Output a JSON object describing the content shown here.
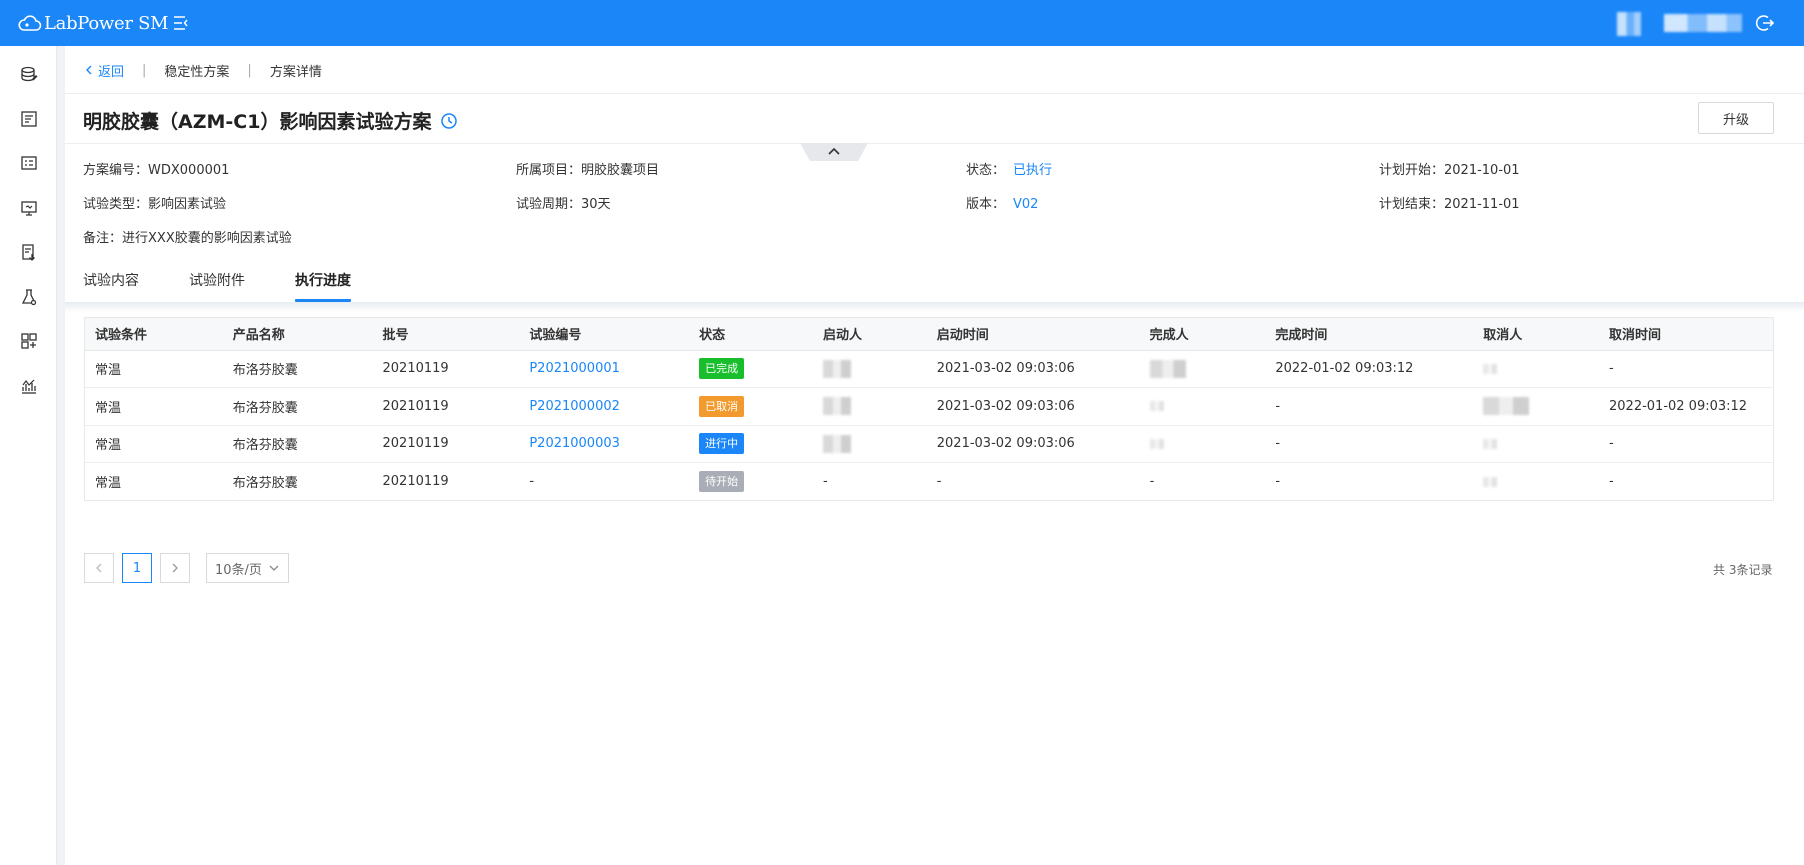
{
  "header": {
    "app_name": "LabPower SM"
  },
  "breadcrumb": {
    "back": "返回",
    "level1": "稳定性方案",
    "level2": "方案详情"
  },
  "page": {
    "title": "明胶胶囊（AZM-C1）影响因素试验方案",
    "upgrade_label": "升级"
  },
  "info": {
    "plan_no_label": "方案编号：",
    "plan_no": "WDX000001",
    "project_label": "所属项目：",
    "project": "明胶胶囊项目",
    "status_label": "状态：",
    "status": "已执行",
    "plan_start_label": "计划开始：",
    "plan_start": "2021-10-01",
    "test_type_label": "试验类型：",
    "test_type": "影响因素试验",
    "cycle_label": "试验周期：",
    "cycle": "30天",
    "version_label": "版本：",
    "version": "V02",
    "plan_end_label": "计划结束：",
    "plan_end": "2021-11-01",
    "remark_label": "备注：",
    "remark": "进行XXX胶囊的影响因素试验"
  },
  "tabs": [
    {
      "label": "试验内容"
    },
    {
      "label": "试验附件"
    },
    {
      "label": "执行进度"
    }
  ],
  "table": {
    "columns": [
      "试验条件",
      "产品名称",
      "批号",
      "试验编号",
      "状态",
      "启动人",
      "启动时间",
      "完成人",
      "完成时间",
      "取消人",
      "取消时间"
    ],
    "rows": [
      {
        "condition": "常温",
        "product": "布洛芬胶囊",
        "batch": "20210119",
        "test_no": "P2021000001",
        "status": "已完成",
        "status_color": "#19be2c",
        "start_time": "2021-03-02 09:03:06",
        "finish_time": "2022-01-02 09:03:12",
        "cancel_time": "-"
      },
      {
        "condition": "常温",
        "product": "布洛芬胶囊",
        "batch": "20210119",
        "test_no": "P2021000002",
        "status": "已取消",
        "status_color": "#f29a2e",
        "start_time": "2021-03-02 09:03:06",
        "finish_time": "-",
        "cancel_time": "2022-01-02 09:03:12"
      },
      {
        "condition": "常温",
        "product": "布洛芬胶囊",
        "batch": "20210119",
        "test_no": "P2021000003",
        "status": "进行中",
        "status_color": "#1a86f8",
        "start_time": "2021-03-02 09:03:06",
        "finish_time": "-",
        "cancel_time": "-"
      },
      {
        "condition": "常温",
        "product": "布洛芬胶囊",
        "batch": "20210119",
        "test_no": "-",
        "status": "待开始",
        "status_color": "#a9adb6",
        "starter": "-",
        "start_time": "-",
        "finisher": "-",
        "finish_time": "-",
        "cancel_time": "-"
      }
    ]
  },
  "pagination": {
    "current_page": "1",
    "page_size": "10条/页",
    "total": "共 3条记录"
  },
  "colors": {
    "primary": "#1a86f8"
  }
}
